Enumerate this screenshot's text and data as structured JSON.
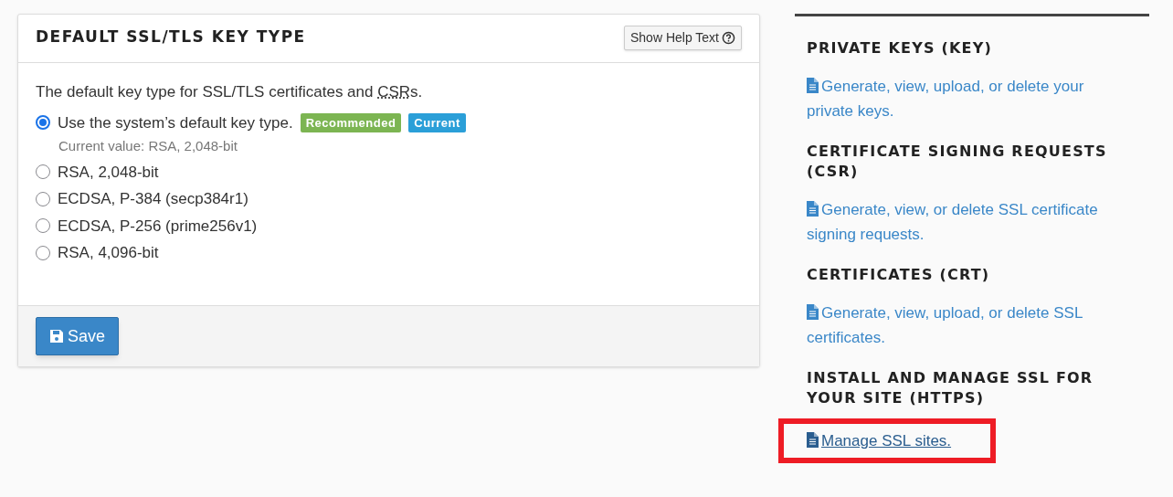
{
  "panel": {
    "title": "DEFAULT SSL/TLS KEY TYPE",
    "help_button": "Show Help Text",
    "description": {
      "before": "The default key type for SSL/TLS certificates and ",
      "abbr": "CSR",
      "after": "s."
    },
    "options": [
      {
        "label": "Use the system’s default key type.",
        "selected": true,
        "badges": [
          {
            "text": "Recommended",
            "color": "#7cb552"
          },
          {
            "text": "Current",
            "color": "#2b9fd8"
          }
        ],
        "note": "Current value: RSA, 2,048-bit"
      },
      {
        "label": "RSA, 2,048-bit",
        "selected": false
      },
      {
        "label": "ECDSA, P-384 (secp384r1)",
        "selected": false
      },
      {
        "label": "ECDSA, P-256 (prime256v1)",
        "selected": false
      },
      {
        "label": "RSA, 4,096-bit",
        "selected": false
      }
    ],
    "save_button": "Save"
  },
  "sidebar": {
    "sections": [
      {
        "heading": "PRIVATE KEYS (KEY)",
        "link": "Generate, view, upload, or delete your private keys.",
        "highlighted": false
      },
      {
        "heading": "CERTIFICATE SIGNING REQUESTS (CSR)",
        "link": "Generate, view, or delete SSL certificate signing requests.",
        "highlighted": false
      },
      {
        "heading": "CERTIFICATES (CRT)",
        "link": "Generate, view, upload, or delete SSL certificates.",
        "highlighted": false
      },
      {
        "heading": "INSTALL AND MANAGE SSL FOR YOUR SITE (HTTPS)",
        "link": "Manage SSL sites.",
        "highlighted": true
      }
    ]
  }
}
